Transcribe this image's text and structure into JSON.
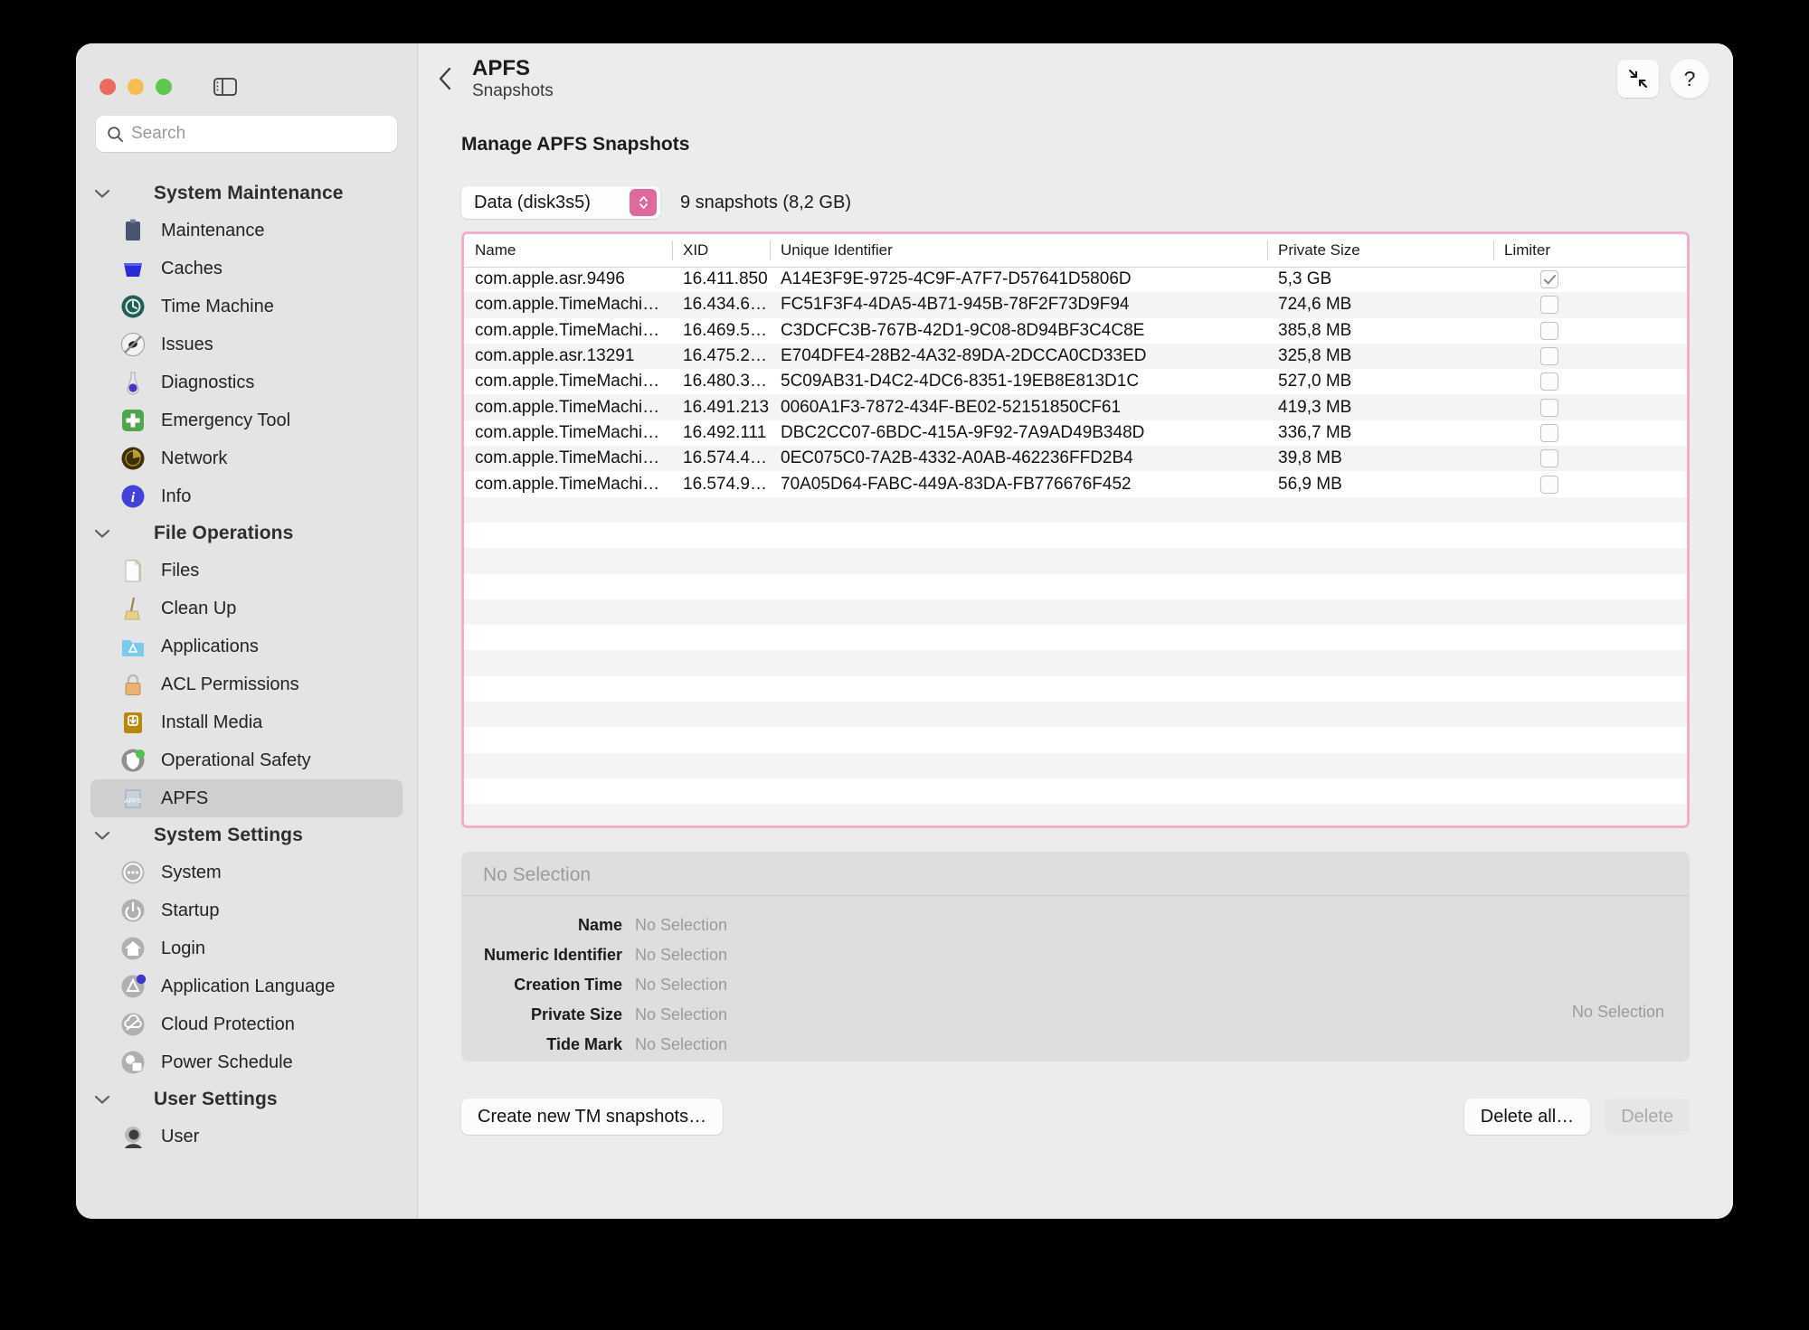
{
  "window": {
    "traffic_lights": [
      "close",
      "minimize",
      "zoom"
    ],
    "sidebar_toggle_icon": "sidebar-toggle-icon"
  },
  "search": {
    "placeholder": "Search",
    "value": "",
    "icon": "search-icon"
  },
  "sidebar": {
    "groups": [
      {
        "title": "System Maintenance",
        "items": [
          {
            "label": "Maintenance",
            "icon": "clipboard-icon"
          },
          {
            "label": "Caches",
            "icon": "bin-icon"
          },
          {
            "label": "Time Machine",
            "icon": "time-machine-icon"
          },
          {
            "label": "Issues",
            "icon": "no-bug-icon"
          },
          {
            "label": "Diagnostics",
            "icon": "diagnostics-icon"
          },
          {
            "label": "Emergency Tool",
            "icon": "first-aid-icon"
          },
          {
            "label": "Network",
            "icon": "radar-icon"
          },
          {
            "label": "Info",
            "icon": "info-icon"
          }
        ]
      },
      {
        "title": "File Operations",
        "items": [
          {
            "label": "Files",
            "icon": "document-icon"
          },
          {
            "label": "Clean Up",
            "icon": "broom-icon"
          },
          {
            "label": "Applications",
            "icon": "applications-folder-icon"
          },
          {
            "label": "ACL Permissions",
            "icon": "padlock-icon"
          },
          {
            "label": "Install Media",
            "icon": "install-media-icon"
          },
          {
            "label": "Operational Safety",
            "icon": "shield-check-icon"
          },
          {
            "label": "APFS",
            "icon": "apfs-disk-icon",
            "selected": true
          }
        ]
      },
      {
        "title": "System Settings",
        "items": [
          {
            "label": "System",
            "icon": "ellipsis-circle-icon"
          },
          {
            "label": "Startup",
            "icon": "power-icon"
          },
          {
            "label": "Login",
            "icon": "home-icon"
          },
          {
            "label": "Application Language",
            "icon": "app-language-icon"
          },
          {
            "label": "Cloud Protection",
            "icon": "cloud-slash-icon"
          },
          {
            "label": "Power Schedule",
            "icon": "power-schedule-icon"
          }
        ]
      },
      {
        "title": "User Settings",
        "items": [
          {
            "label": "User",
            "icon": "user-icon"
          }
        ]
      }
    ]
  },
  "titlebar": {
    "back_icon": "chevron-left-icon",
    "title": "APFS",
    "subtitle": "Snapshots",
    "collapse_icon": "collapse-arrows-icon",
    "help_label": "?"
  },
  "main": {
    "heading": "Manage APFS Snapshots",
    "volume_popup": {
      "value": "Data (disk3s5)",
      "stepper_icon": "chevron-updown-icon",
      "accent": "#e0699f"
    },
    "snapshot_count_label": "9 snapshots (8,2 GB)",
    "table": {
      "columns": [
        "Name",
        "XID",
        "Unique Identifier",
        "Private Size",
        "Limiter"
      ],
      "rows": [
        {
          "name": "com.apple.asr.9496",
          "xid": "16.411.850",
          "uid": "A14E3F9E-9725-4C9F-A7F7-D57641D5806D",
          "size": "5,3 GB",
          "limiter": true
        },
        {
          "name": "com.apple.TimeMachi…",
          "xid": "16.434.6…",
          "uid": "FC51F3F4-4DA5-4B71-945B-78F2F73D9F94",
          "size": "724,6 MB",
          "limiter": false
        },
        {
          "name": "com.apple.TimeMachi…",
          "xid": "16.469.5…",
          "uid": "C3DCFC3B-767B-42D1-9C08-8D94BF3C4C8E",
          "size": "385,8 MB",
          "limiter": false
        },
        {
          "name": "com.apple.asr.13291",
          "xid": "16.475.2…",
          "uid": "E704DFE4-28B2-4A32-89DA-2DCCA0CD33ED",
          "size": "325,8 MB",
          "limiter": false
        },
        {
          "name": "com.apple.TimeMachi…",
          "xid": "16.480.3…",
          "uid": "5C09AB31-D4C2-4DC6-8351-19EB8E813D1C",
          "size": "527,0 MB",
          "limiter": false
        },
        {
          "name": "com.apple.TimeMachi…",
          "xid": "16.491.213",
          "uid": "0060A1F3-7872-434F-BE02-52151850CF61",
          "size": "419,3 MB",
          "limiter": false
        },
        {
          "name": "com.apple.TimeMachi…",
          "xid": "16.492.111",
          "uid": "DBC2CC07-6BDC-415A-9F92-7A9AD49B348D",
          "size": "336,7 MB",
          "limiter": false
        },
        {
          "name": "com.apple.TimeMachi…",
          "xid": "16.574.4…",
          "uid": "0EC075C0-7A2B-4332-A0AB-462236FFD2B4",
          "size": "39,8 MB",
          "limiter": false
        },
        {
          "name": "com.apple.TimeMachi…",
          "xid": "16.574.9…",
          "uid": "70A05D64-FABC-449A-83DA-FB776676F452",
          "size": "56,9 MB",
          "limiter": false
        }
      ],
      "empty_row_count": 16,
      "border_color": "#efafcd"
    },
    "inspector": {
      "header": "No Selection",
      "fields": [
        {
          "key": "Name",
          "value": "No Selection"
        },
        {
          "key": "Numeric Identifier",
          "value": "No Selection"
        },
        {
          "key": "Creation Time",
          "value": "No Selection"
        },
        {
          "key": "Private Size",
          "value": "No Selection"
        },
        {
          "key": "Tide Mark",
          "value": "No Selection"
        }
      ],
      "corner_value": "No Selection"
    },
    "footer": {
      "create_label": "Create new TM snapshots…",
      "delete_all_label": "Delete all…",
      "delete_label": "Delete",
      "delete_disabled": true
    }
  }
}
